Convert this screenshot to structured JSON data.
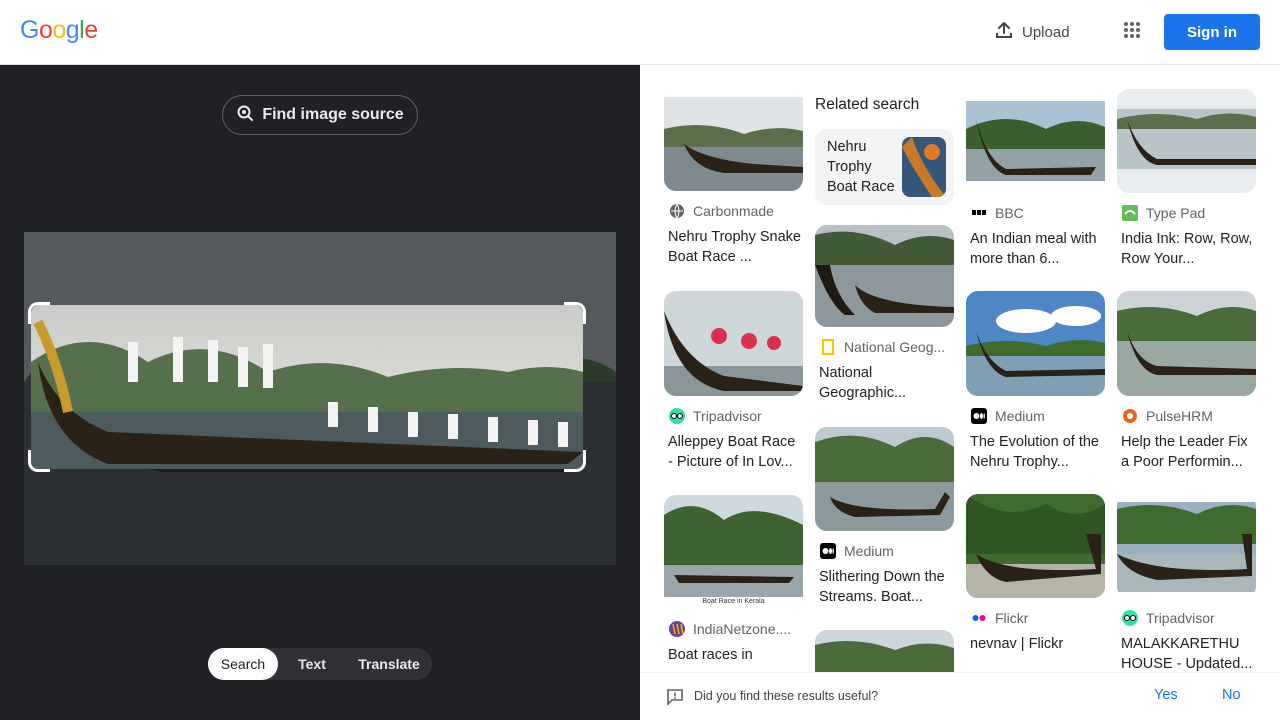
{
  "header": {
    "logo": [
      "G",
      "o",
      "o",
      "g",
      "l",
      "e"
    ],
    "logo_colors": [
      "#4285F4",
      "#EA4335",
      "#FBBC05",
      "#4285F4",
      "#34A853",
      "#EA4335"
    ],
    "upload_label": "Upload",
    "signin_label": "Sign in"
  },
  "left": {
    "find_source_label": "Find image source",
    "tabs": [
      "Search",
      "Text",
      "Translate"
    ],
    "active_tab": "Search"
  },
  "right": {
    "related_heading": "Related search",
    "related_card_text": "Nehru Trophy Boat Race",
    "results": [
      {
        "source": "Carbonmade",
        "title": "Nehru Trophy Snake Boat Race ...",
        "icon": "globe-icon"
      },
      {
        "source": "BBC",
        "title": "An Indian meal with more than 6...",
        "icon": "bbc-icon"
      },
      {
        "source": "Type Pad",
        "title": "India Ink: Row, Row, Row Your...",
        "icon": "typepad-icon"
      },
      {
        "source": "National Geog...",
        "title": "National Geographic...",
        "icon": "natgeo-icon"
      },
      {
        "source": "Tripadvisor",
        "title": "Alleppey Boat Race - Picture of In Lov...",
        "icon": "tripadvisor-icon"
      },
      {
        "source": "Medium",
        "title": "The Evolution of the Nehru Trophy...",
        "icon": "medium-icon"
      },
      {
        "source": "PulseHRM",
        "title": "Help the Leader Fix a Poor Performin...",
        "icon": "pulsehrm-icon"
      },
      {
        "source": "Medium",
        "title": "Slithering Down the Streams. Boat...",
        "icon": "medium-icon"
      },
      {
        "source": "IndiaNetzone....",
        "title": "Boat races in",
        "icon": "indianetzone-icon"
      },
      {
        "source": "Flickr",
        "title": "nevnav | Flickr",
        "icon": "flickr-icon"
      },
      {
        "source": "Tripadvisor",
        "title": "MALAKKARETHU HOUSE - Updated...",
        "icon": "tripadvisor-icon"
      }
    ],
    "thumb_caption": "Boat Race in Kerala"
  },
  "feedback": {
    "question": "Did you find these results useful?",
    "yes": "Yes",
    "no": "No"
  },
  "colors": {
    "accent": "#1a73e8",
    "left_bg": "#202124"
  }
}
